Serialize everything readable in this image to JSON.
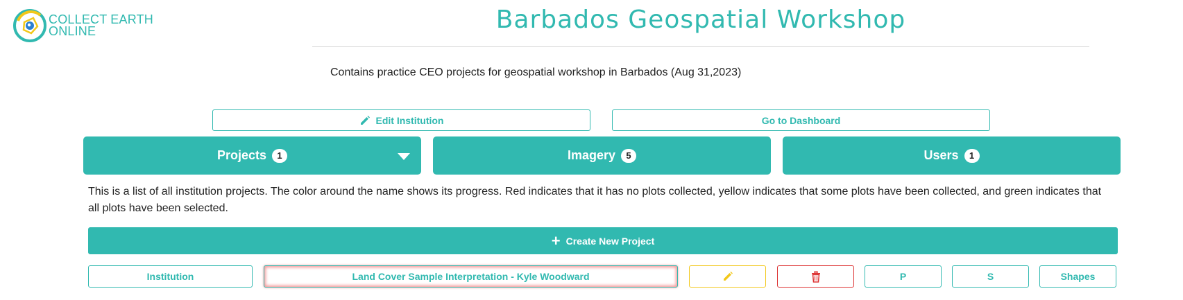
{
  "brand": {
    "line1": "COLLECT EARTH",
    "line2": "ONLINE"
  },
  "header": {
    "title": "Barbados Geospatial Workshop"
  },
  "institution": {
    "description": "Contains practice CEO projects for geospatial workshop in Barbados (Aug 31,2023)"
  },
  "actions": {
    "edit_label": "Edit Institution",
    "dashboard_label": "Go to Dashboard"
  },
  "tabs": [
    {
      "label": "Projects",
      "count": "1"
    },
    {
      "label": "Imagery",
      "count": "5"
    },
    {
      "label": "Users",
      "count": "1"
    }
  ],
  "projects_panel": {
    "info": "This is a list of all institution projects. The color around the name shows its progress. Red indicates that it has no plots collected, yellow indicates that some plots have been collected, and green indicates that all plots have been selected.",
    "create_label": "Create New Project",
    "row": {
      "institution_label": "Institution",
      "name": "Land Cover Sample Interpretation - Kyle Woodward",
      "p_label": "P",
      "s_label": "S",
      "shapes_label": "Shapes"
    }
  },
  "colors": {
    "accent": "#31b9b0",
    "progress_none": "#f29a9a",
    "edit": "#f2c81a",
    "delete": "#d33333"
  }
}
